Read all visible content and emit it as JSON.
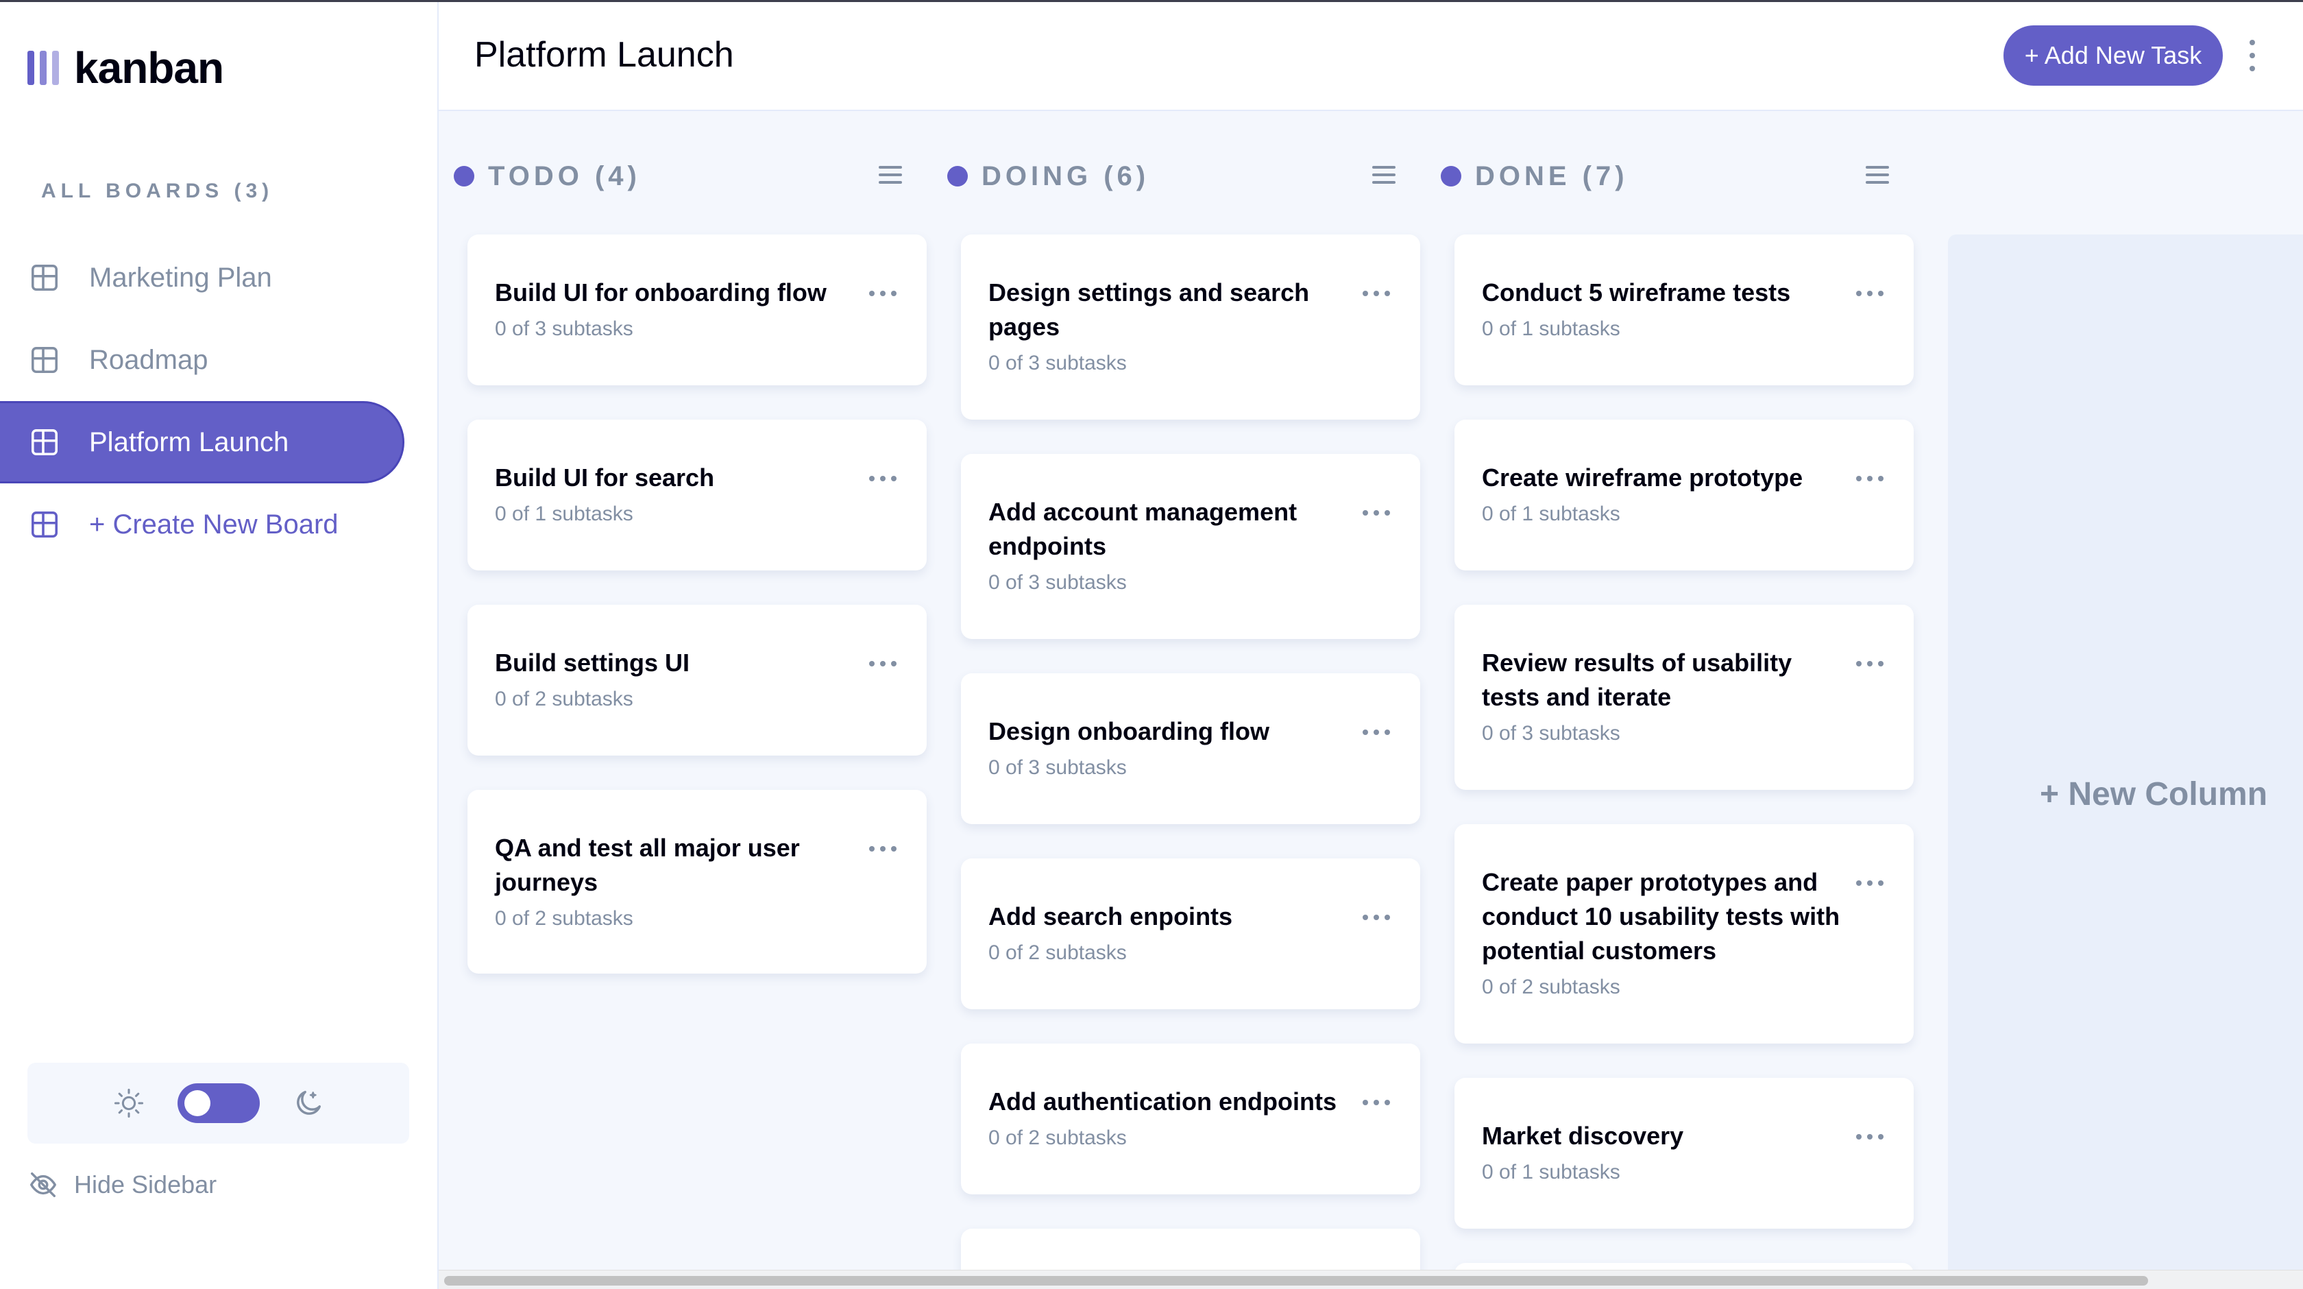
{
  "app": {
    "logo_text": "kanban"
  },
  "colors": {
    "accent": "#635fc7",
    "text": "#000112",
    "muted": "#828fa3",
    "bg": "#f4f7fd"
  },
  "sidebar": {
    "heading": "ALL BOARDS (3)",
    "boards": [
      {
        "label": "Marketing Plan",
        "active": false
      },
      {
        "label": "Roadmap",
        "active": false
      },
      {
        "label": "Platform Launch",
        "active": true
      }
    ],
    "create_label": "+ Create New Board",
    "hide_label": "Hide Sidebar",
    "theme": {
      "mode": "light",
      "light_icon": "sun-icon",
      "dark_icon": "moon-icon"
    }
  },
  "header": {
    "title": "Platform Launch",
    "add_task_label": "+ Add New Task",
    "menu_icon": "vertical-ellipsis-icon"
  },
  "columns": [
    {
      "title": "TODO (4)",
      "tasks": [
        {
          "title": "Build UI for onboarding flow",
          "subtasks": "0 of 3 subtasks"
        },
        {
          "title": "Build UI for search",
          "subtasks": "0 of 1 subtasks"
        },
        {
          "title": "Build settings UI",
          "subtasks": "0 of 2 subtasks"
        },
        {
          "title": "QA and test all major user journeys",
          "subtasks": "0 of 2 subtasks"
        }
      ]
    },
    {
      "title": "DOING (6)",
      "tasks": [
        {
          "title": "Design settings and search pages",
          "subtasks": "0 of 3 subtasks"
        },
        {
          "title": "Add account management endpoints",
          "subtasks": "0 of 3 subtasks"
        },
        {
          "title": "Design onboarding flow",
          "subtasks": "0 of 3 subtasks"
        },
        {
          "title": "Add search enpoints",
          "subtasks": "0 of 2 subtasks"
        },
        {
          "title": "Add authentication endpoints",
          "subtasks": "0 of 2 subtasks"
        }
      ]
    },
    {
      "title": "DONE (7)",
      "tasks": [
        {
          "title": "Conduct 5 wireframe tests",
          "subtasks": "0 of 1 subtasks"
        },
        {
          "title": "Create wireframe prototype",
          "subtasks": "0 of 1 subtasks"
        },
        {
          "title": "Review results of usability tests and iterate",
          "subtasks": "0 of 3 subtasks"
        },
        {
          "title": "Create paper prototypes and conduct 10 usability tests with potential customers",
          "subtasks": "0 of 2 subtasks"
        },
        {
          "title": "Market discovery",
          "subtasks": "0 of 1 subtasks"
        }
      ]
    }
  ],
  "new_column_label": "+ New Column"
}
